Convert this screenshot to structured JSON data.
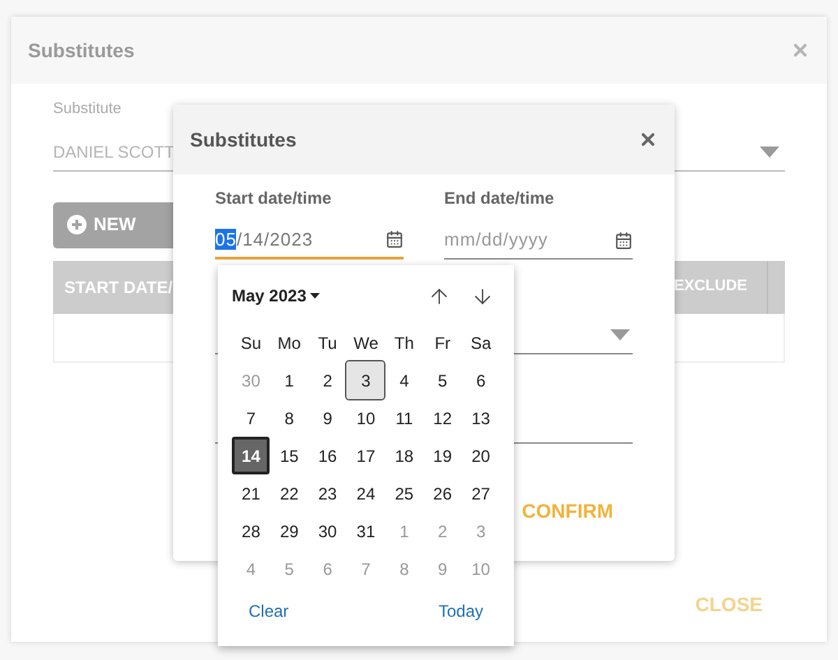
{
  "outer_dialog": {
    "title": "Substitutes",
    "substitute": {
      "label": "Substitute",
      "value": "DANIEL SCOTT"
    },
    "new_button": "NEW",
    "table": {
      "columns": [
        "START DATE/",
        "EXCLUDE"
      ]
    },
    "close_button": "CLOSE"
  },
  "inner_dialog": {
    "title": "Substitutes",
    "start": {
      "label": "Start date/time",
      "focused": true,
      "segments": [
        {
          "text": "05",
          "highlighted": true
        },
        {
          "text": "/14/2023",
          "highlighted": false
        }
      ]
    },
    "end": {
      "label": "End date/time",
      "placeholder": "mm/dd/yyyy",
      "focused": false
    },
    "confirm_button": "CONFIRM"
  },
  "calendar": {
    "month": "May 2023",
    "weekdays": [
      "Su",
      "Mo",
      "Tu",
      "We",
      "Th",
      "Fr",
      "Sa"
    ],
    "days": [
      {
        "text": "30",
        "outside": true,
        "today": false,
        "selected": false
      },
      {
        "text": "1",
        "outside": false,
        "today": false,
        "selected": false
      },
      {
        "text": "2",
        "outside": false,
        "today": false,
        "selected": false
      },
      {
        "text": "3",
        "outside": false,
        "today": true,
        "selected": false
      },
      {
        "text": "4",
        "outside": false,
        "today": false,
        "selected": false
      },
      {
        "text": "5",
        "outside": false,
        "today": false,
        "selected": false
      },
      {
        "text": "6",
        "outside": false,
        "today": false,
        "selected": false
      },
      {
        "text": "7",
        "outside": false,
        "today": false,
        "selected": false
      },
      {
        "text": "8",
        "outside": false,
        "today": false,
        "selected": false
      },
      {
        "text": "9",
        "outside": false,
        "today": false,
        "selected": false
      },
      {
        "text": "10",
        "outside": false,
        "today": false,
        "selected": false
      },
      {
        "text": "11",
        "outside": false,
        "today": false,
        "selected": false
      },
      {
        "text": "12",
        "outside": false,
        "today": false,
        "selected": false
      },
      {
        "text": "13",
        "outside": false,
        "today": false,
        "selected": false
      },
      {
        "text": "14",
        "outside": false,
        "today": false,
        "selected": true
      },
      {
        "text": "15",
        "outside": false,
        "today": false,
        "selected": false
      },
      {
        "text": "16",
        "outside": false,
        "today": false,
        "selected": false
      },
      {
        "text": "17",
        "outside": false,
        "today": false,
        "selected": false
      },
      {
        "text": "18",
        "outside": false,
        "today": false,
        "selected": false
      },
      {
        "text": "19",
        "outside": false,
        "today": false,
        "selected": false
      },
      {
        "text": "20",
        "outside": false,
        "today": false,
        "selected": false
      },
      {
        "text": "21",
        "outside": false,
        "today": false,
        "selected": false
      },
      {
        "text": "22",
        "outside": false,
        "today": false,
        "selected": false
      },
      {
        "text": "23",
        "outside": false,
        "today": false,
        "selected": false
      },
      {
        "text": "24",
        "outside": false,
        "today": false,
        "selected": false
      },
      {
        "text": "25",
        "outside": false,
        "today": false,
        "selected": false
      },
      {
        "text": "26",
        "outside": false,
        "today": false,
        "selected": false
      },
      {
        "text": "27",
        "outside": false,
        "today": false,
        "selected": false
      },
      {
        "text": "28",
        "outside": false,
        "today": false,
        "selected": false
      },
      {
        "text": "29",
        "outside": false,
        "today": false,
        "selected": false
      },
      {
        "text": "30",
        "outside": false,
        "today": false,
        "selected": false
      },
      {
        "text": "31",
        "outside": false,
        "today": false,
        "selected": false
      },
      {
        "text": "1",
        "outside": true,
        "today": false,
        "selected": false
      },
      {
        "text": "2",
        "outside": true,
        "today": false,
        "selected": false
      },
      {
        "text": "3",
        "outside": true,
        "today": false,
        "selected": false
      },
      {
        "text": "4",
        "outside": true,
        "today": false,
        "selected": false
      },
      {
        "text": "5",
        "outside": true,
        "today": false,
        "selected": false
      },
      {
        "text": "6",
        "outside": true,
        "today": false,
        "selected": false
      },
      {
        "text": "7",
        "outside": true,
        "today": false,
        "selected": false
      },
      {
        "text": "8",
        "outside": true,
        "today": false,
        "selected": false
      },
      {
        "text": "9",
        "outside": true,
        "today": false,
        "selected": false
      },
      {
        "text": "10",
        "outside": true,
        "today": false,
        "selected": false
      }
    ],
    "clear": "Clear",
    "today": "Today"
  }
}
